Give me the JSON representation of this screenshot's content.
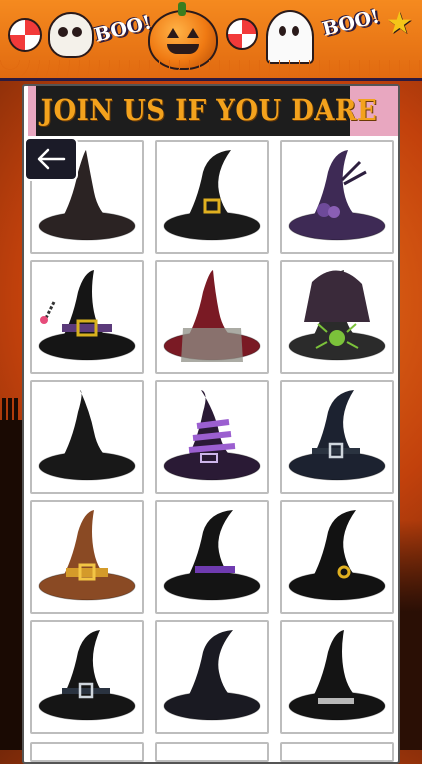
{
  "header": {
    "title": "JOIN US IF YOU DARE"
  },
  "banner": {
    "boo_left": "BOO!",
    "boo_right": "BOO!"
  },
  "colors": {
    "banner": "#e8741a",
    "header_bg": "#1d1d1d",
    "title": "#f3a21d",
    "accent_pink": "#e8a7c0",
    "background": "#c2410c"
  },
  "hats": [
    {
      "label": "black-velvet-witch-hat-icon",
      "band": "none",
      "color": "#2b2323"
    },
    {
      "label": "black-hat-gold-buckle-icon",
      "band": "buckle",
      "color": "#1a1a1a"
    },
    {
      "label": "purple-feather-witch-hat-icon",
      "band": "flower",
      "color": "#3e2a55"
    },
    {
      "label": "black-hat-chain-buckle-icon",
      "band": "buckle-purple",
      "color": "#151515"
    },
    {
      "label": "red-hat-with-veil-icon",
      "band": "veil",
      "color": "#7a1a24"
    },
    {
      "label": "green-spider-hat-icon",
      "band": "spider",
      "color": "#2b2b2b"
    },
    {
      "label": "black-crooked-witch-hat-icon",
      "band": "none",
      "color": "#181818"
    },
    {
      "label": "purple-striped-witch-hat-icon",
      "band": "stripes",
      "color": "#2a1a35"
    },
    {
      "label": "dark-blue-witch-hat-buckle-icon",
      "band": "buckle-silver",
      "color": "#1c2230"
    },
    {
      "label": "brown-wizard-hat-icon",
      "band": "buckle-gold",
      "color": "#8a4a24"
    },
    {
      "label": "black-hat-purple-band-icon",
      "band": "purple-band",
      "color": "#141414"
    },
    {
      "label": "black-hat-round-buckle-icon",
      "band": "round-buckle",
      "color": "#121212"
    },
    {
      "label": "small-black-witch-hat-icon",
      "band": "buckle-silver",
      "color": "#151515"
    },
    {
      "label": "black-hat-with-spider-icon",
      "band": "none",
      "color": "#1a1a22"
    },
    {
      "label": "black-hat-silver-band-icon",
      "band": "silver-band",
      "color": "#141414"
    }
  ]
}
